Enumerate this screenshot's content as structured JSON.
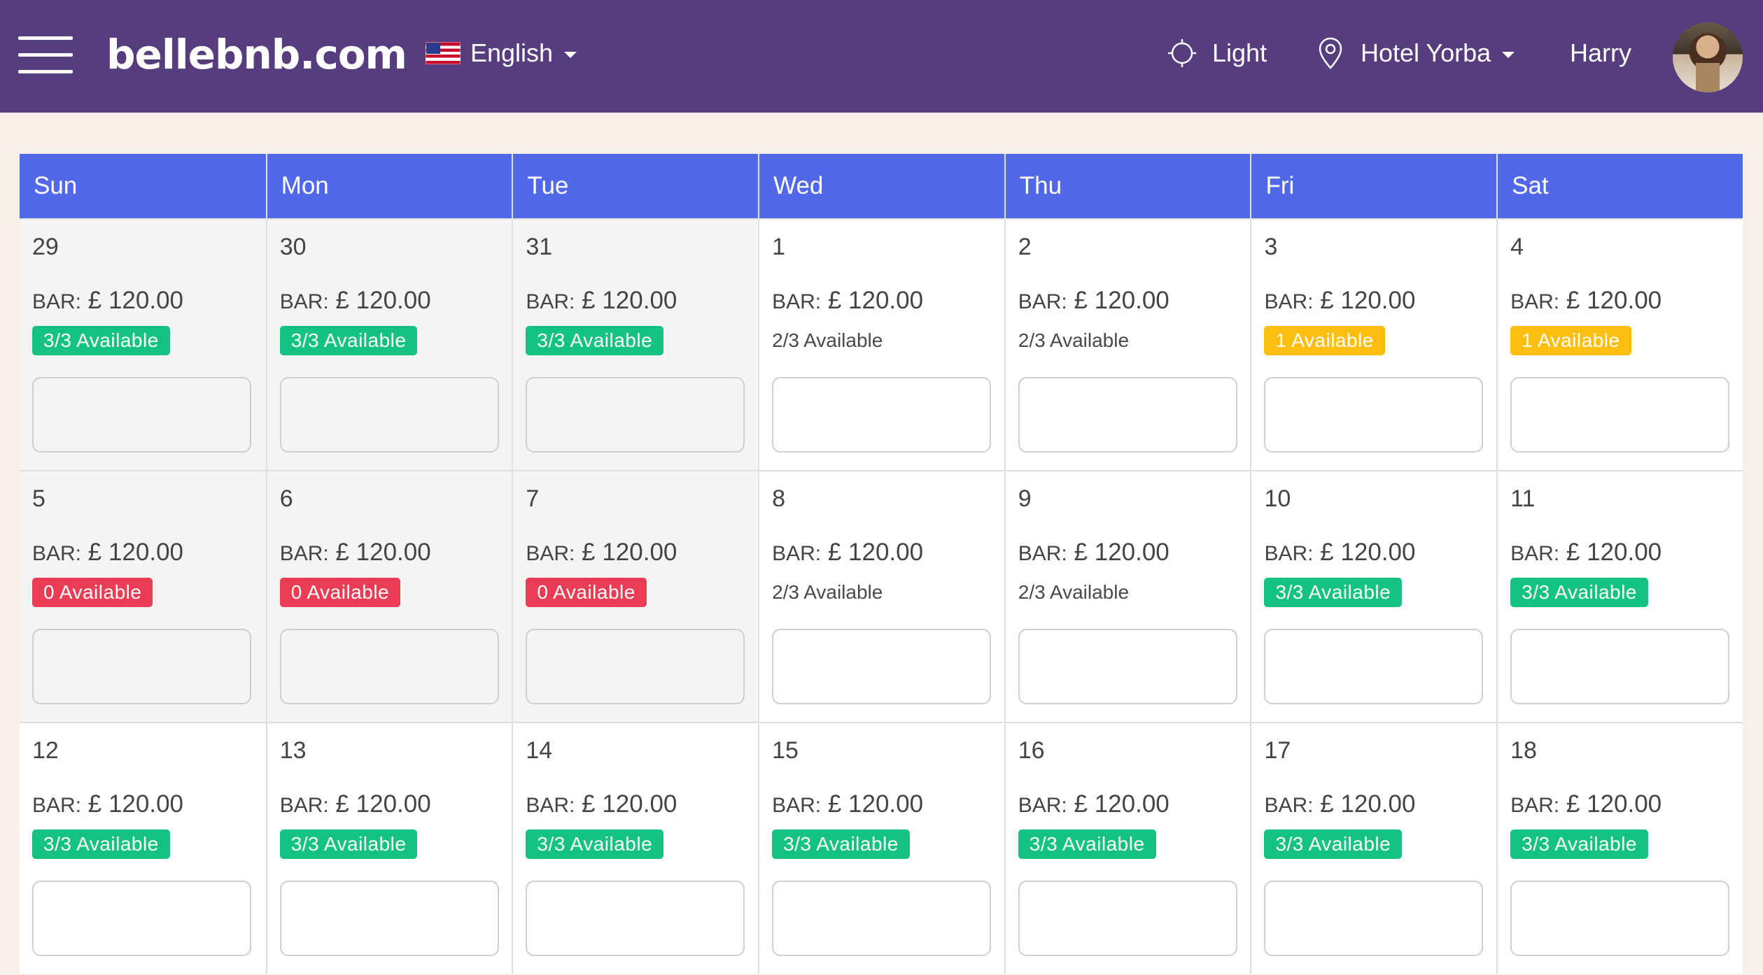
{
  "header": {
    "logo": "bellebnb.com",
    "language": "English",
    "theme": "Light",
    "hotel": "Hotel Yorba",
    "user": "Harry"
  },
  "colors": {
    "header_bg": "#553d7e",
    "weekday_bg": "#5169e8",
    "green": "#14c381",
    "yellow": "#fdbe0f",
    "red": "#ea3d55"
  },
  "calendar": {
    "weekdays": [
      "Sun",
      "Mon",
      "Tue",
      "Wed",
      "Thu",
      "Fri",
      "Sat"
    ],
    "weeks": [
      {
        "days": [
          {
            "num": "29",
            "bar_label": "BAR:",
            "bar_value": "£ 120.00",
            "avail": "3/3 Available",
            "status": "green",
            "past": true
          },
          {
            "num": "30",
            "bar_label": "BAR:",
            "bar_value": "£ 120.00",
            "avail": "3/3 Available",
            "status": "green",
            "past": true
          },
          {
            "num": "31",
            "bar_label": "BAR:",
            "bar_value": "£ 120.00",
            "avail": "3/3 Available",
            "status": "green",
            "past": true
          },
          {
            "num": "1",
            "bar_label": "BAR:",
            "bar_value": "£ 120.00",
            "avail": "2/3 Available",
            "status": "plain",
            "past": false
          },
          {
            "num": "2",
            "bar_label": "BAR:",
            "bar_value": "£ 120.00",
            "avail": "2/3 Available",
            "status": "plain",
            "past": false
          },
          {
            "num": "3",
            "bar_label": "BAR:",
            "bar_value": "£ 120.00",
            "avail": "1 Available",
            "status": "yellow",
            "past": false
          },
          {
            "num": "4",
            "bar_label": "BAR:",
            "bar_value": "£ 120.00",
            "avail": "1 Available",
            "status": "yellow",
            "past": false
          }
        ]
      },
      {
        "days": [
          {
            "num": "5",
            "bar_label": "BAR:",
            "bar_value": "£ 120.00",
            "avail": "0 Available",
            "status": "red",
            "past": true
          },
          {
            "num": "6",
            "bar_label": "BAR:",
            "bar_value": "£ 120.00",
            "avail": "0 Available",
            "status": "red",
            "past": true
          },
          {
            "num": "7",
            "bar_label": "BAR:",
            "bar_value": "£ 120.00",
            "avail": "0 Available",
            "status": "red",
            "past": true
          },
          {
            "num": "8",
            "bar_label": "BAR:",
            "bar_value": "£ 120.00",
            "avail": "2/3 Available",
            "status": "plain",
            "past": false
          },
          {
            "num": "9",
            "bar_label": "BAR:",
            "bar_value": "£ 120.00",
            "avail": "2/3 Available",
            "status": "plain",
            "past": false
          },
          {
            "num": "10",
            "bar_label": "BAR:",
            "bar_value": "£ 120.00",
            "avail": "3/3 Available",
            "status": "green",
            "past": false
          },
          {
            "num": "11",
            "bar_label": "BAR:",
            "bar_value": "£ 120.00",
            "avail": "3/3 Available",
            "status": "green",
            "past": false
          }
        ]
      },
      {
        "days": [
          {
            "num": "12",
            "bar_label": "BAR:",
            "bar_value": "£ 120.00",
            "avail": "3/3 Available",
            "status": "green",
            "past": false
          },
          {
            "num": "13",
            "bar_label": "BAR:",
            "bar_value": "£ 120.00",
            "avail": "3/3 Available",
            "status": "green",
            "past": false
          },
          {
            "num": "14",
            "bar_label": "BAR:",
            "bar_value": "£ 120.00",
            "avail": "3/3 Available",
            "status": "green",
            "past": false
          },
          {
            "num": "15",
            "bar_label": "BAR:",
            "bar_value": "£ 120.00",
            "avail": "3/3 Available",
            "status": "green",
            "past": false
          },
          {
            "num": "16",
            "bar_label": "BAR:",
            "bar_value": "£ 120.00",
            "avail": "3/3 Available",
            "status": "green",
            "past": false
          },
          {
            "num": "17",
            "bar_label": "BAR:",
            "bar_value": "£ 120.00",
            "avail": "3/3 Available",
            "status": "green",
            "past": false
          },
          {
            "num": "18",
            "bar_label": "BAR:",
            "bar_value": "£ 120.00",
            "avail": "3/3 Available",
            "status": "green",
            "past": false
          }
        ]
      }
    ]
  }
}
